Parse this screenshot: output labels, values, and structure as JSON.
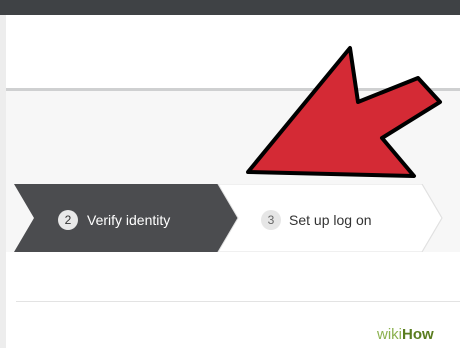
{
  "wizard": {
    "steps": [
      {
        "number": "2",
        "label": "Verify identity",
        "state": "active"
      },
      {
        "number": "3",
        "label": "Set up log on",
        "state": "upcoming"
      }
    ]
  },
  "colors": {
    "active_step": "#4b4c4f",
    "arrow_fill": "#d42a35",
    "arrow_outline": "#000000",
    "top_bar": "#3f4245"
  },
  "watermark": {
    "prefix": "wiki",
    "suffix": "How"
  }
}
